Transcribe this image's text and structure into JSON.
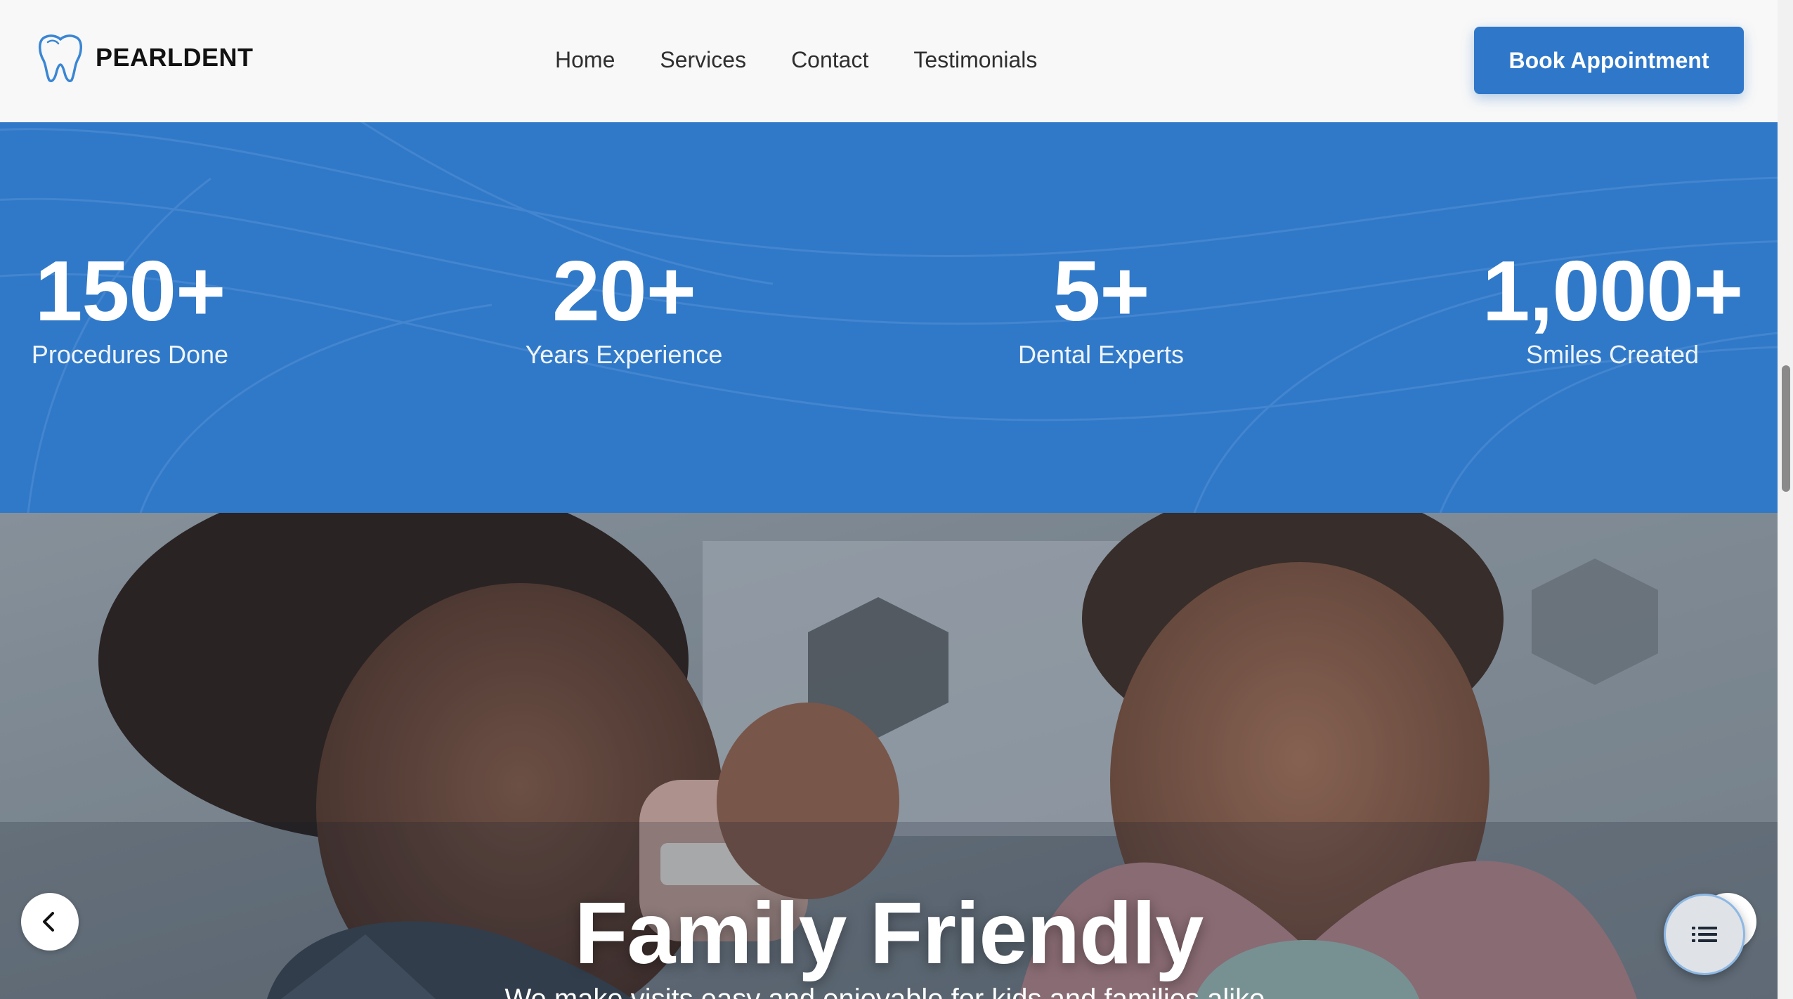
{
  "brand": {
    "name": "PEARLDENT",
    "logo_icon": "tooth-icon",
    "accent": "#2f78c9"
  },
  "nav": {
    "items": [
      {
        "label": "Home"
      },
      {
        "label": "Services"
      },
      {
        "label": "Contact"
      },
      {
        "label": "Testimonials"
      }
    ]
  },
  "header": {
    "cta_label": "Book Appointment"
  },
  "stats": {
    "band_color": "#3079c8",
    "items": [
      {
        "value": "150+",
        "label": "Procedures Done"
      },
      {
        "value": "20+",
        "label": "Years Experience"
      },
      {
        "value": "5+",
        "label": "Dental Experts"
      },
      {
        "value": "1,000+",
        "label": "Smiles Created"
      }
    ]
  },
  "hero": {
    "title": "Family Friendly",
    "subtitle": "We make visits easy and enjoyable for kids and families alike.",
    "prev_icon": "chevron-left-icon",
    "next_icon": "chevron-right-icon",
    "menu_icon": "list-icon"
  }
}
